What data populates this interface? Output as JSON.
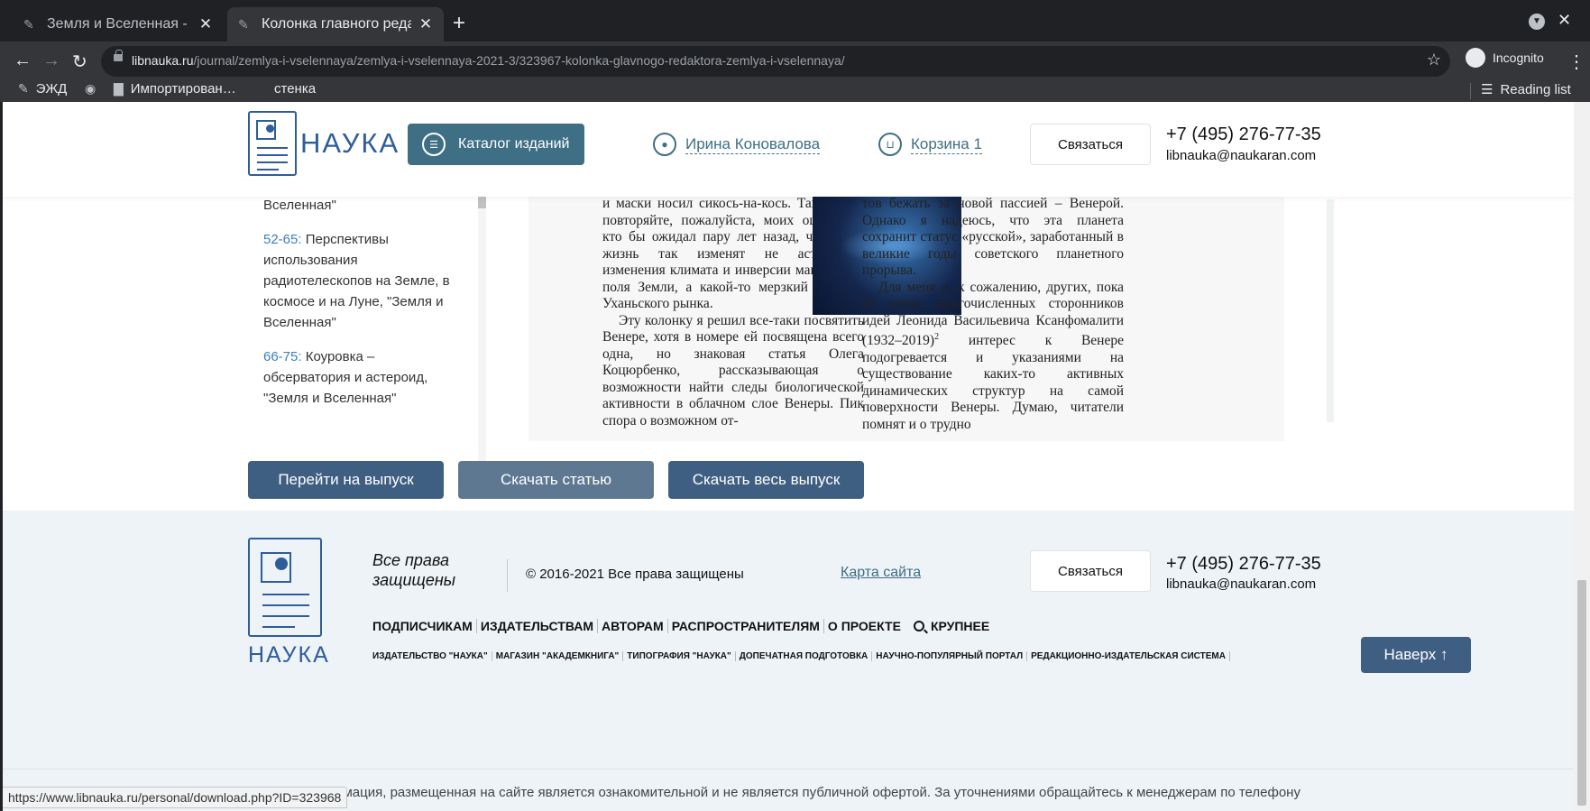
{
  "browser": {
    "tabs": [
      {
        "title": "Земля и Вселенная - libn",
        "active": false
      },
      {
        "title": "Колонка главного редакт",
        "active": true
      }
    ],
    "url_host": "libnauka.ru",
    "url_path": "/journal/zemlya-i-vselennaya/zemlya-i-vselennaya-2021-3/323967-kolonka-glavnogo-redaktora-zemlya-i-vselennaya/",
    "incognito_label": "Incognito",
    "bookmarks": [
      "ЭЖД",
      "Импортирован…",
      "стенка"
    ],
    "reading_list": "Reading list",
    "status_url": "https://www.libnauka.ru/personal/download.php?ID=323968"
  },
  "header": {
    "logo_text": "НАУКА",
    "catalog_label": "Каталог изданий",
    "user_name": "Ирина Коновалова",
    "cart_label": "Корзина 1",
    "contact_label": "Связаться",
    "phone": "+7 (495) 276-77-35",
    "email": "libnauka@naukaran.com"
  },
  "toc": {
    "top_text": "сюрпризов, \"Земля и Вселенная\"",
    "items": [
      {
        "pages": "52-65:",
        "title": " Перспективы использования радиотелескопов на Земле, в космосе и на Луне, \"Земля и Вселенная\""
      },
      {
        "pages": "66-75:",
        "title": " Коуровка – обсерватория и астероид, \"Земля и Вселенная\""
      }
    ]
  },
  "article": {
    "col1_p1": "и маски носил сикось-на-кось. Так что не повторяйте, пожалуйста, моих ошибок – кто бы ожидал пару лет назад, что нашу жизнь так изменят не астероиды, изменения климата и инверсии магнитного поля Земли, а какой-то мерзкий вирус с Уханьского рынка.",
    "col1_p2": "Эту колонку я решил все-таки посвятить Венере, хотя в номере ей посвящена всего одна, но знаковая статья Олега Коцюрбенко, рассказывающая о возможности найти следы биологической активности в облачном слое Венеры. Пик спора о возможном от-",
    "col2_p1": "тов бежать за новой пассией – Венерой. Однако я надеюсь, что эта планета сохранит статус «русской», заработанный в великие годы советского планетного прорыва.",
    "col2_p2a": "Для меня и, к сожалению, других, пока не очень многочисленных сторонников идей Леонида Васильевича Ксанфомалити (1932–2019)",
    "col2_sup": "2",
    "col2_p2b": " интерес к Венере подогревается и указаниями на существование каких-то активных динамических структур на самой поверхности Венеры. Думаю, читатели помнят и о трудно"
  },
  "actions": {
    "goto_issue": "Перейти на выпуск",
    "download_article": "Скачать статью",
    "download_issue": "Скачать весь выпуск"
  },
  "footer": {
    "logo_text": "НАУКА",
    "rights": "Все права защищены",
    "copyright": "© 2016-2021 Все права защищены",
    "sitemap": "Карта сайта",
    "contact_label": "Связаться",
    "phone": "+7 (495) 276-77-35",
    "email": "libnauka@naukaran.com",
    "main_nav": [
      "ПОДПИСЧИКАМ",
      "ИЗДАТЕЛЬСТВАМ",
      "АВТОРАМ",
      "РАСПРОСТРАНИТЕЛЯМ",
      "О ПРОЕКТЕ"
    ],
    "zoom_label": "КРУПНЕЕ",
    "sub_nav": [
      "ИЗДАТЕЛЬСТВО \"НАУКА\"",
      "МАГАЗИН \"АКАДЕМКНИГА\"",
      "ТИПОГРАФИЯ \"НАУКА\"",
      "ДОПЕЧАТНАЯ ПОДГОТОВКА",
      "НАУЧНО-ПОПУЛЯРНЫЙ ПОРТАЛ",
      "РЕДАКЦИОННО-ИЗДАТЕЛЬСКАЯ СИСТЕМА"
    ],
    "top_button": "Наверх ↑",
    "disclaimer": "Вся информация, размещенная на сайте является ознакомительной и не является публичной офертой. За уточнениями обращайтесь к менеджерам по телефону"
  },
  "colors": {
    "brand_blue": "#2f5d9a",
    "catalog_teal": "#3e6f84",
    "action_button": "#3f5f82"
  }
}
